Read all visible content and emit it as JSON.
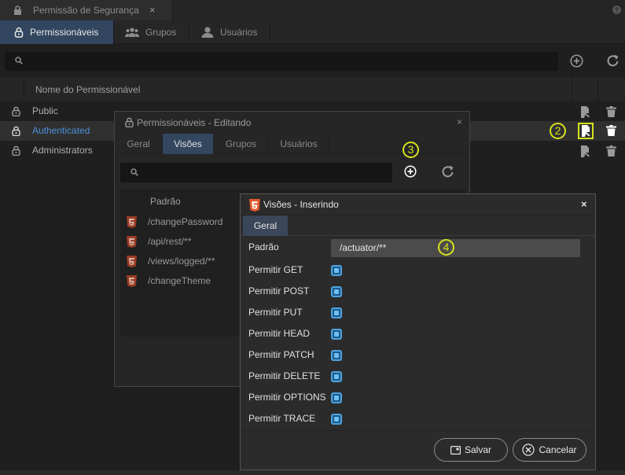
{
  "window": {
    "title": "Permissão de Segurança",
    "close": "×",
    "help": "?"
  },
  "main_tabs": [
    {
      "label": "Permissionáveis",
      "active": true,
      "icon": "lock-icon"
    },
    {
      "label": "Grupos",
      "active": false,
      "icon": "group-icon"
    },
    {
      "label": "Usuários",
      "active": false,
      "icon": "user-icon"
    }
  ],
  "list": {
    "header": "Nome do Permissionável",
    "rows": [
      {
        "name": "Public",
        "selected": false
      },
      {
        "name": "Authenticated",
        "selected": true
      },
      {
        "name": "Administrators",
        "selected": false
      }
    ]
  },
  "edit_dialog": {
    "title": "Permissionáveis - Editando",
    "close": "×",
    "tabs": [
      {
        "label": "Geral",
        "active": false
      },
      {
        "label": "Visões",
        "active": true
      },
      {
        "label": "Grupos",
        "active": false
      },
      {
        "label": "Usuários",
        "active": false
      }
    ],
    "list_header": "Padrão",
    "patterns": [
      "/changePassword",
      "/api/rest/**",
      "/views/logged/**",
      "/changeTheme"
    ]
  },
  "vis_dialog": {
    "title": "Visões - Inserindo",
    "close": "×",
    "tab": "Geral",
    "padrao_label": "Padrão",
    "padrao_value": "/actuator/**",
    "permissions": [
      {
        "label": "Permitir GET",
        "checked": true
      },
      {
        "label": "Permitir POST",
        "checked": true
      },
      {
        "label": "Permitir PUT",
        "checked": true
      },
      {
        "label": "Permitir HEAD",
        "checked": true
      },
      {
        "label": "Permitir PATCH",
        "checked": true
      },
      {
        "label": "Permitir DELETE",
        "checked": true
      },
      {
        "label": "Permitir OPTIONS",
        "checked": true
      },
      {
        "label": "Permitir TRACE",
        "checked": true
      }
    ],
    "save_label": "Salvar",
    "cancel_label": "Cancelar"
  },
  "markers": [
    "2",
    "3",
    "4"
  ],
  "colors": {
    "accent": "#33465f",
    "selected_text": "#4a90d9",
    "marker": "#d7e21c",
    "checkbox": "#4fa3e0"
  }
}
